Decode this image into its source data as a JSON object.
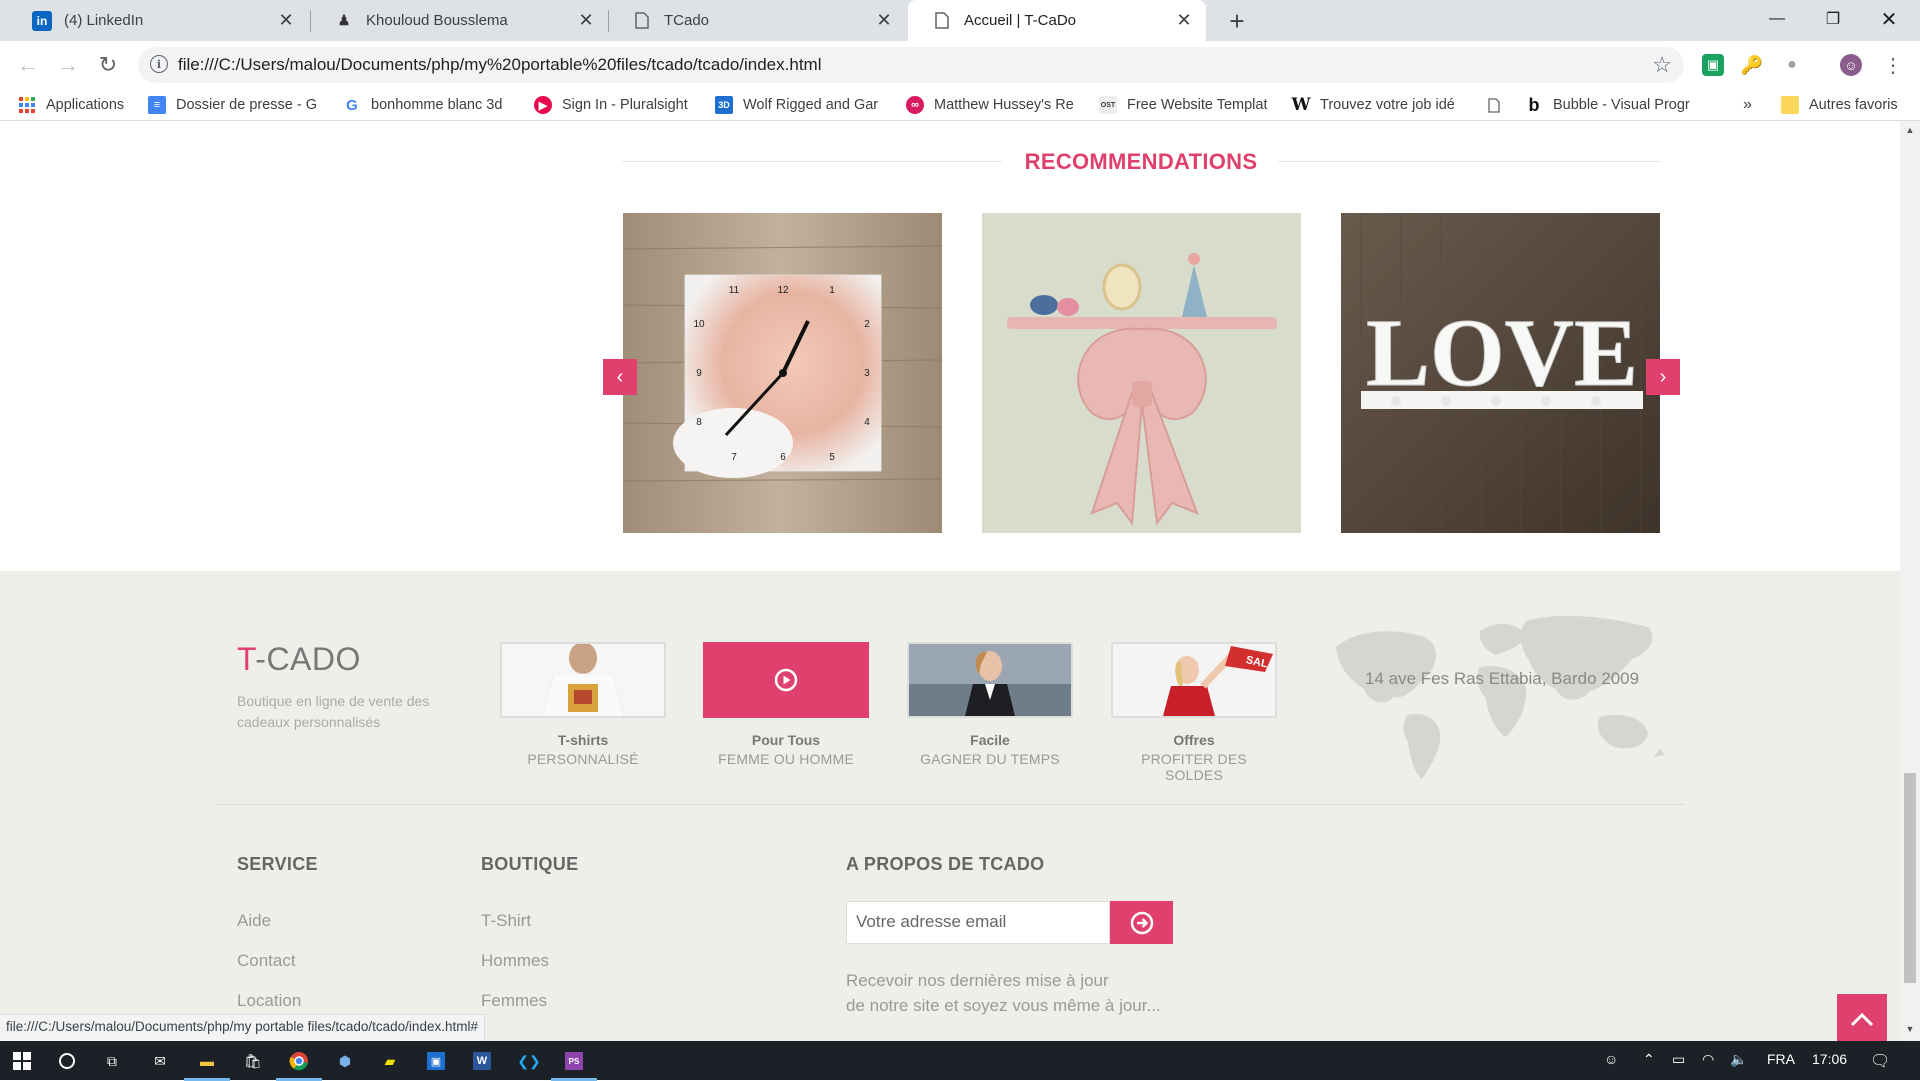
{
  "browser": {
    "tabs": [
      {
        "title": "(4) LinkedIn",
        "icon": "linkedin-icon",
        "active": false
      },
      {
        "title": "Khouloud Bousslema",
        "icon": "profile-icon",
        "active": false
      },
      {
        "title": "TCado",
        "icon": "page-icon",
        "active": false
      },
      {
        "title": "Accueil | T-CaDo",
        "icon": "page-icon",
        "active": true
      }
    ],
    "url": "file:///C:/Users/malou/Documents/php/my%20portable%20files/tcado/tcado/index.html",
    "bookmarks": [
      {
        "label": "Applications",
        "icon": "apps-grid-icon"
      },
      {
        "label": "Dossier de presse - G",
        "icon": "google-docs-icon"
      },
      {
        "label": "bonhomme blanc 3d",
        "icon": "google-icon"
      },
      {
        "label": "Sign In - Pluralsight",
        "icon": "pluralsight-icon"
      },
      {
        "label": "Wolf Rigged and Gar",
        "icon": "3d-icon"
      },
      {
        "label": "Matthew Hussey's Re",
        "icon": "hussey-icon"
      },
      {
        "label": "Free Website Templat",
        "icon": "ost-icon"
      },
      {
        "label": "Trouvez votre job idé",
        "icon": "w-icon"
      },
      {
        "label": "Bubble - Visual Progr",
        "icon": "bubble-icon"
      }
    ],
    "overflow": "»",
    "other_bookmarks": "Autres favoris",
    "status_url": "file:///C:/Users/malou/Documents/php/my portable files/tcado/tcado/index.html#"
  },
  "recommendations": {
    "title": "RECOMMENDATIONS",
    "items": [
      {
        "name": "baby photo clock",
        "clock_numbers": [
          "11",
          "12",
          "1",
          "2",
          "3",
          "4",
          "5",
          "6",
          "7",
          "8",
          "9",
          "10"
        ]
      },
      {
        "name": "pink bow shelf"
      },
      {
        "name": "love coat rack",
        "word": "LOVE"
      }
    ]
  },
  "footer": {
    "brand_t": "T",
    "brand_rest": "-CADO",
    "description": "Boutique en ligne de vente des cadeaux personnalisés",
    "features": [
      {
        "title": "T-shirts",
        "subtitle": "PERSONNALISÉ"
      },
      {
        "title": "Pour Tous",
        "subtitle": "FEMME OU HOMME"
      },
      {
        "title": "Facile",
        "subtitle": "GAGNER DU TEMPS"
      },
      {
        "title": "Offres",
        "subtitle": "PROFITER DES SOLDES"
      }
    ],
    "sale_tag": "SAL",
    "address": "14 ave Fes Ras Ettabia, Bardo 2009",
    "columns": {
      "service": {
        "title": "SERVICE",
        "links": [
          "Aide",
          "Contact",
          "Location"
        ]
      },
      "boutique": {
        "title": "BOUTIQUE",
        "links": [
          "T-Shirt",
          "Hommes",
          "Femmes"
        ]
      },
      "about": {
        "title": "A PROPOS DE TCADO"
      }
    },
    "email_placeholder": "Votre adresse email",
    "newsletter_line1": "Recevoir nos dernières mise à jour",
    "newsletter_line2": "de notre site et soyez vous même à jour..."
  },
  "taskbar": {
    "language": "FRA",
    "time": "17:06"
  },
  "colors": {
    "accent": "#e0406e",
    "footer_bg": "#efefe9",
    "taskbar": "#1c2127"
  }
}
